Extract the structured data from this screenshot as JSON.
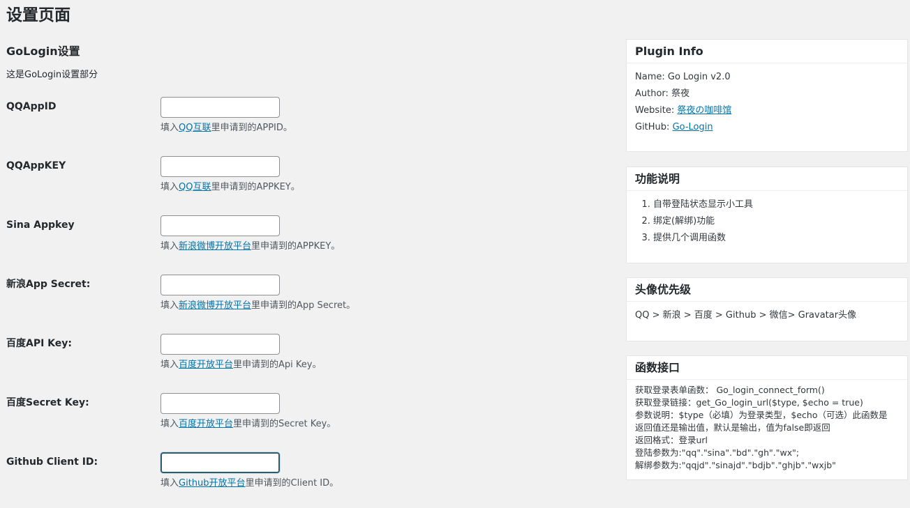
{
  "page": {
    "title": "设置页面"
  },
  "section": {
    "title": "GoLogin设置",
    "description": "这是GoLogin设置部分"
  },
  "fields": [
    {
      "label": "QQAppID",
      "value": "",
      "help_prefix": "填入",
      "help_link": "QQ互联",
      "help_suffix": "里申请到的APPID。"
    },
    {
      "label": "QQAppKEY",
      "value": "",
      "help_prefix": "填入",
      "help_link": "QQ互联",
      "help_suffix": "里申请到的APPKEY。"
    },
    {
      "label": "Sina Appkey",
      "value": "",
      "help_prefix": "填入",
      "help_link": "新浪微博开放平台",
      "help_suffix": "里申请到的APPKEY。"
    },
    {
      "label": "新浪App Secret:",
      "value": "",
      "help_prefix": "填入",
      "help_link": "新浪微博开放平台",
      "help_suffix": "里申请到的App Secret。"
    },
    {
      "label": "百度API Key:",
      "value": "",
      "help_prefix": "填入",
      "help_link": "百度开放平台",
      "help_suffix": "里申请到的Api Key。"
    },
    {
      "label": "百度Secret Key:",
      "value": "",
      "help_prefix": "填入",
      "help_link": "百度开放平台",
      "help_suffix": "里申请到的Secret Key。"
    },
    {
      "label": "Github Client ID:",
      "value": "",
      "help_prefix": "填入",
      "help_link": "Github开放平台",
      "help_suffix": "里申请到的Client ID。"
    }
  ],
  "plugin_info": {
    "title": "Plugin Info",
    "name_label": "Name: ",
    "name_value": "Go Login v2.0",
    "author_label": "Author: ",
    "author_value": "祭夜",
    "website_label": "Website: ",
    "website_link": "祭夜の咖啡馆",
    "github_label": "GitHub: ",
    "github_link": "Go-Login"
  },
  "features": {
    "title": "功能说明",
    "items": [
      "自带登陆状态显示小工具",
      "绑定(解绑)功能",
      "提供几个调用函数"
    ]
  },
  "avatar_priority": {
    "title": "头像优先级",
    "text": "QQ > 新浪 > 百度 > Github > 微信> Gravatar头像"
  },
  "api": {
    "title": "函数接口",
    "lines": [
      "获取登录表单函数：  Go_login_connect_form()",
      "获取登录链接：get_Go_login_url($type, $echo = true)",
      "参数说明：$type（必填）为登录类型，$echo（可选）此函数是",
      "返回值还是输出值，默认是输出，值为false即返回",
      "返回格式：登录url",
      "登陆参数为:\"qq\".\"sina\".\"bd\".\"gh\".\"wx\";",
      "解绑参数为:\"qqjd\".\"sinajd\".\"bdjb\".\"ghjb\".\"wxjb\""
    ]
  }
}
